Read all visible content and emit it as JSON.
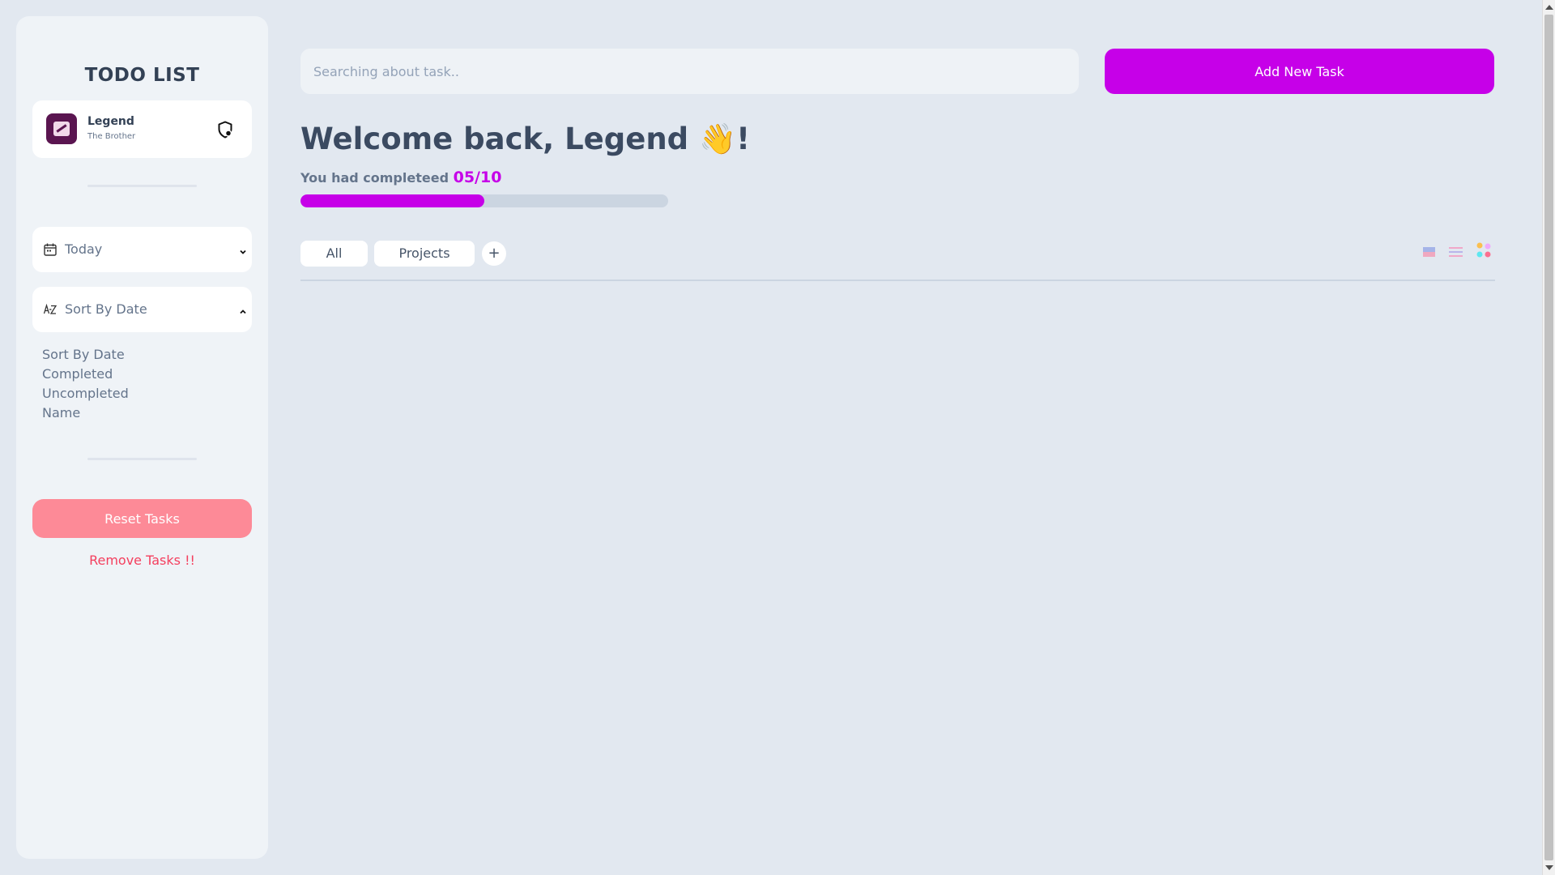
{
  "sidebar": {
    "title": "TODO LIST",
    "user": {
      "name": "Legend",
      "subtitle": "The Brother",
      "avatar_icon": "logo-icon",
      "action_icon": "shield-icon"
    },
    "date_filter": {
      "label": "Today",
      "icon": "calendar-icon",
      "chevron": "chevron-down-icon"
    },
    "sort": {
      "label": "Sort By Date",
      "icon": "sort-az-icon",
      "chevron": "chevron-up-icon",
      "options": [
        "Sort By Date",
        "Completed",
        "Uncompleted",
        "Name"
      ]
    },
    "reset_label": "Reset Tasks",
    "remove_label": "Remove Tasks !!"
  },
  "header": {
    "search_placeholder": "Searching about task..",
    "add_label": "Add New Task"
  },
  "welcome": {
    "greeting": "Welcome back, Legend 👋!",
    "progress_prefix": "You had completeed",
    "progress_count": "05/10",
    "progress_fraction": 0.5
  },
  "tabs": {
    "items": [
      "All",
      "Projects"
    ],
    "add_label": "+"
  },
  "view_icons": [
    "grid-view-icon",
    "list-view-icon",
    "dots-view-icon"
  ],
  "colors": {
    "accent": "#c600e8",
    "reset": "#fd8a97",
    "danger": "#f43f5e",
    "background": "#e2e8f0",
    "sidebar": "#eff3f7"
  }
}
